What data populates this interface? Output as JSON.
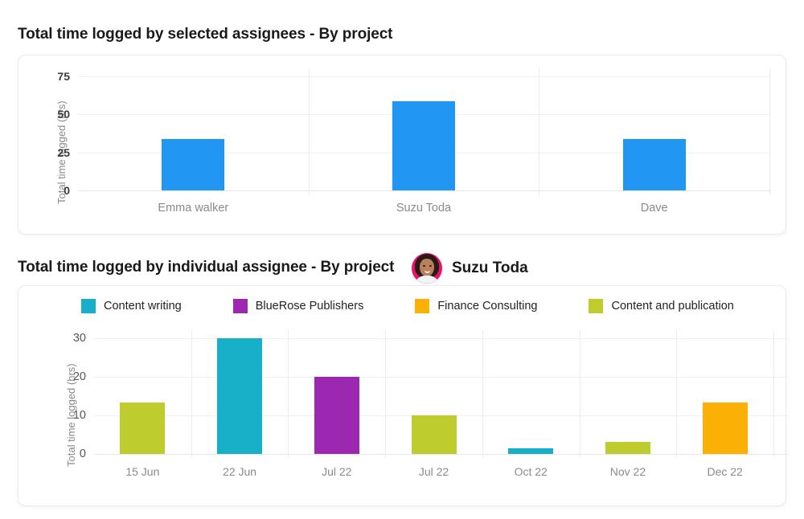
{
  "charts": [
    {
      "title": "Total time logged by selected assignees - By project",
      "ylabel": "Total time  logged (hrs)"
    },
    {
      "title": "Total time logged by individual assignee - By project",
      "assignee": "Suzu Toda",
      "ylabel": "Total time  logged (hrs)"
    }
  ],
  "colors": {
    "blue": "#2196f3",
    "cyan": "#17b0c8",
    "purple": "#9c27b0",
    "orange": "#fbb005",
    "olive": "#bfcc2e",
    "avatar_ring": "#e8116c",
    "gridline": "#f0f0f0",
    "tick_text": "#8a8a8a"
  },
  "chart_data": [
    {
      "type": "bar",
      "title": "Total time logged by selected assignees - By project",
      "xlabel": "",
      "ylabel": "Total time  logged (hrs)",
      "categories": [
        "Emma walker",
        "Suzu Toda",
        "Dave"
      ],
      "values": [
        34,
        58.5,
        34
      ],
      "yticks": [
        0,
        25,
        50,
        75
      ],
      "ylim": [
        0,
        75
      ],
      "colors": [
        "#2196f3",
        "#2196f3",
        "#2196f3"
      ],
      "grid": true,
      "legend": false
    },
    {
      "type": "bar",
      "title": "Total time logged by individual assignee - By project",
      "subtitle": "Suzu Toda",
      "xlabel": "",
      "ylabel": "Total time  logged (hrs)",
      "categories": [
        "15 Jun",
        "22 Jun",
        "Jul 22",
        "Jul 22",
        "Oct 22",
        "Nov 22",
        "Dec 22"
      ],
      "values": [
        13.3,
        30,
        20,
        10,
        1.5,
        3.2,
        13.3
      ],
      "bar_series": [
        "Content and publication",
        "Content writing",
        "BlueRose Publishers",
        "Content and publication",
        "Content writing",
        "Content and publication",
        "Finance Consulting"
      ],
      "bar_colors": [
        "#bfcc2e",
        "#17b0c8",
        "#9c27b0",
        "#bfcc2e",
        "#17b0c8",
        "#bfcc2e",
        "#fbb005"
      ],
      "yticks": [
        0,
        10,
        20,
        30
      ],
      "ylim": [
        0,
        30
      ],
      "grid": true,
      "legend": true,
      "legend_position": "top-left",
      "series": [
        {
          "name": "Content writing",
          "color": "#17b0c8"
        },
        {
          "name": "BlueRose Publishers",
          "color": "#9c27b0"
        },
        {
          "name": "Finance Consulting",
          "color": "#fbb005"
        },
        {
          "name": "Content and publication",
          "color": "#bfcc2e"
        }
      ]
    }
  ]
}
